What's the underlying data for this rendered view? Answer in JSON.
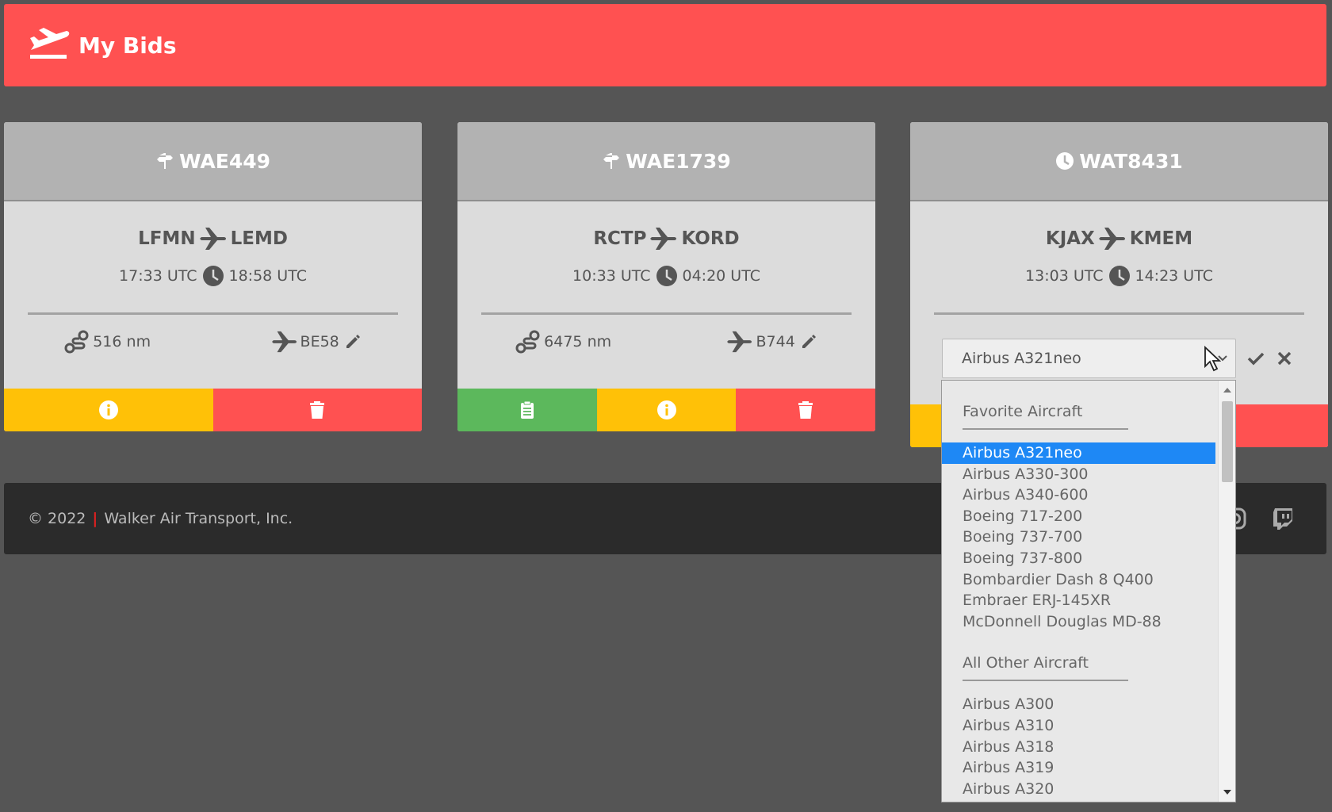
{
  "header": {
    "title": "My Bids"
  },
  "cards": [
    {
      "flight": "WAE449",
      "status_icon": "signpost-icon",
      "origin": "LFMN",
      "destination": "LEMD",
      "dep_time": "17:33 UTC",
      "arr_time": "18:58 UTC",
      "distance": "516 nm",
      "aircraft": "BE58",
      "actions": [
        "info-button",
        "delete-button"
      ]
    },
    {
      "flight": "WAE1739",
      "status_icon": "signpost-icon",
      "origin": "RCTP",
      "destination": "KORD",
      "dep_time": "10:33 UTC",
      "arr_time": "04:20 UTC",
      "distance": "6475 nm",
      "aircraft": "B744",
      "actions": [
        "briefing-button",
        "info-button",
        "delete-button"
      ]
    },
    {
      "flight": "WAT8431",
      "status_icon": "clock-icon",
      "origin": "KJAX",
      "destination": "KMEM",
      "dep_time": "13:03 UTC",
      "arr_time": "14:23 UTC",
      "aircraft_select": {
        "value": "Airbus A321neo"
      }
    }
  ],
  "dropdown": {
    "favorites_label": "Favorite Aircraft",
    "favorites": [
      "Airbus A321neo",
      "Airbus A330-300",
      "Airbus A340-600",
      "Boeing 717-200",
      "Boeing 737-700",
      "Boeing 737-800",
      "Bombardier Dash 8 Q400",
      "Embraer ERJ-145XR",
      "McDonnell Douglas MD-88"
    ],
    "selected": "Airbus A321neo",
    "others_label": "All Other Aircraft",
    "others": [
      "Airbus A300",
      "Airbus A310",
      "Airbus A318",
      "Airbus A319",
      "Airbus A320"
    ]
  },
  "footer": {
    "copyright": "© 2022",
    "company": "Walker Air Transport, Inc."
  },
  "colors": {
    "header": "#ff5151",
    "info": "#ffc107",
    "delete": "#ff5151",
    "briefing": "#5cb85c",
    "selected": "#1e88f5",
    "background": "#555555",
    "footer": "#2b2b2b"
  }
}
